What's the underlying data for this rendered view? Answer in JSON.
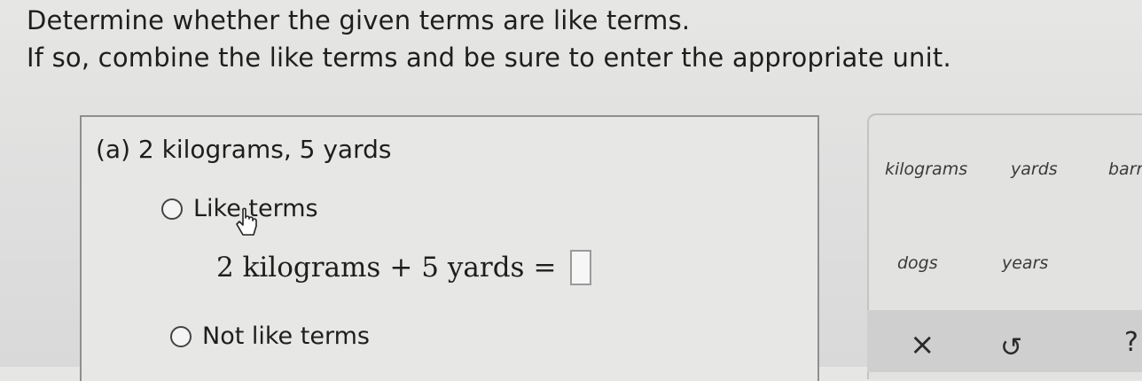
{
  "instructions": {
    "line1": "Determine whether the given terms are like terms.",
    "line2": "If so, combine the like terms and be sure to enter the appropriate unit."
  },
  "question": {
    "label": "(a)  2 kilograms, 5 yards",
    "option_like": "Like terms",
    "option_not": "Not like terms",
    "equation": {
      "term1": "2 kilograms",
      "plus": "+",
      "term2": "5 yards",
      "equals": "="
    }
  },
  "units": {
    "kilograms": "kilograms",
    "yards": "yards",
    "barrels": "barr",
    "dogs": "dogs",
    "years": "years"
  },
  "actions": {
    "clear": "×",
    "undo": "↺",
    "help": "?"
  }
}
